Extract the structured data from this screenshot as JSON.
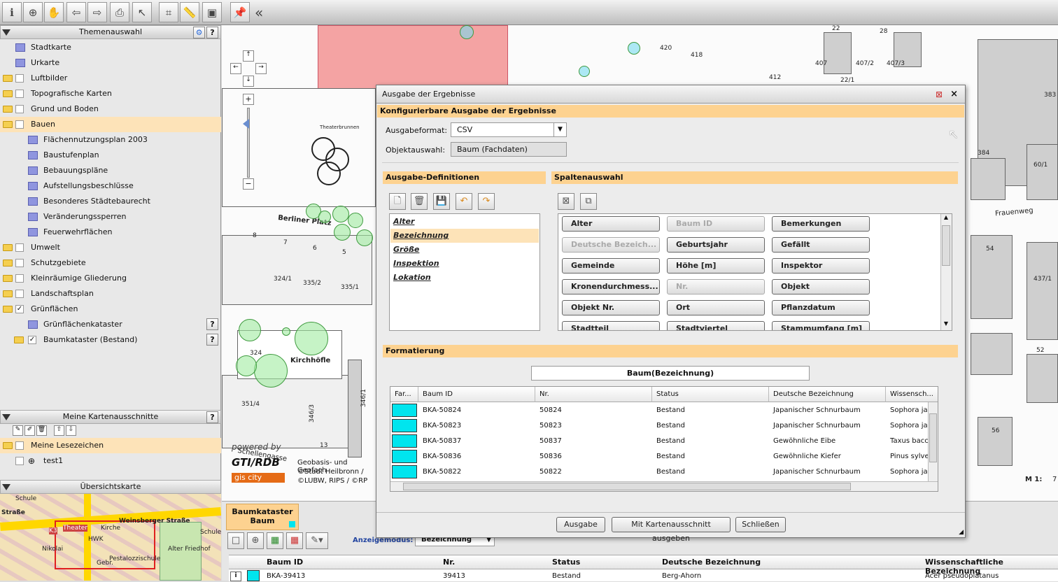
{
  "themen": {
    "header": "Themenauswahl",
    "items": [
      {
        "label": "Stadtkarte"
      },
      {
        "label": "Urkarte"
      },
      {
        "label": "Luftbilder"
      },
      {
        "label": "Topografische Karten"
      },
      {
        "label": "Grund und Boden"
      },
      {
        "label": "Bauen"
      },
      {
        "label": "Flächennutzungsplan 2003"
      },
      {
        "label": "Baustufenplan"
      },
      {
        "label": "Bebauungspläne"
      },
      {
        "label": "Aufstellungsbeschlüsse"
      },
      {
        "label": "Besonderes Städtebaurecht"
      },
      {
        "label": "Veränderungssperren"
      },
      {
        "label": "Feuerwehrflächen"
      },
      {
        "label": "Umwelt"
      },
      {
        "label": "Schutzgebiete"
      },
      {
        "label": "Kleinräumige Gliederung"
      },
      {
        "label": "Landschaftsplan"
      },
      {
        "label": "Grünflächen"
      },
      {
        "label": "Grünflächenkataster"
      },
      {
        "label": "Baumkataster (Bestand)"
      }
    ]
  },
  "kartenausschnitte": {
    "header": "Meine Kartenausschnitte",
    "folder": "Meine Lesezeichen",
    "item": "test1"
  },
  "uebersicht": {
    "header": "Übersichtskarte",
    "labels": [
      "Schule",
      "Straße",
      "Theater",
      "Kirche",
      "Weinsberger Straße",
      "HWK",
      "Pestalozzischule",
      "Alter Friedhof",
      "Gebr.",
      "Nikolai",
      "K3",
      "Schule"
    ]
  },
  "map": {
    "labels": {
      "l1": "Berliner Platz",
      "l2": "Kirchhöfle",
      "l3": "Theaterbrunnen",
      "l4": "Frauenweg",
      "l5": "Schellengasse",
      "m1": "M 1:",
      "m1val": "7"
    },
    "parcels": [
      "22",
      "28",
      "420",
      "418",
      "412",
      "407",
      "407/2",
      "407/3",
      "22/1",
      "383",
      "384",
      "60/1",
      "54",
      "437/1",
      "52",
      "56",
      "8",
      "7",
      "6",
      "5",
      "324/1",
      "335/2",
      "335/1",
      "324",
      "351/4",
      "346/3",
      "346/1",
      "13"
    ],
    "credits": {
      "powered": "powered by",
      "brand": "GTI/RDB",
      "city": "gis city",
      "c1": "Geobasis- und Geofach",
      "c2": "©Stadt Heilbronn /",
      "c3": "©LUBW, RIPS / ©RP"
    }
  },
  "dialog": {
    "title": "Ausgabe der Ergebnisse",
    "subtitle": "Konfigurierbare Ausgabe der Ergebnisse",
    "format_label": "Ausgabeformat:",
    "format_value": "CSV",
    "objekt_label": "Objektauswahl:",
    "objekt_value": "Baum (Fachdaten)",
    "defs_header": "Ausgabe-Definitionen",
    "defs": [
      "Alter",
      "Bezeichnung",
      "Größe",
      "Inspektion",
      "Lokation"
    ],
    "spalten_header": "Spaltenauswahl",
    "spalten": [
      "Alter",
      "Baum ID",
      "Bemerkungen",
      "Deutsche Bezeich...",
      "Geburtsjahr",
      "Gefällt",
      "Gemeinde",
      "Höhe [m]",
      "Inspektor",
      "Kronendurchmess...",
      "Nr.",
      "Objekt",
      "Objekt Nr.",
      "Ort",
      "Pflanzdatum",
      "Stadtteil",
      "Stadtviertel",
      "Stammumfang [m]"
    ],
    "format_header": "Formatierung",
    "format_expr": "Baum(Bezeichnung)",
    "grid": {
      "headers": [
        "Far...",
        "Baum ID",
        "Nr.",
        "Status",
        "Deutsche Bezeichnung",
        "Wissensch..."
      ],
      "rows": [
        [
          "BKA-50824",
          "50824",
          "Bestand",
          "Japanischer Schnurbaum",
          "Sophora jap"
        ],
        [
          "BKA-50823",
          "50823",
          "Bestand",
          "Japanischer Schnurbaum",
          "Sophora jap"
        ],
        [
          "BKA-50837",
          "50837",
          "Bestand",
          "Gewöhnliche Eibe",
          "Taxus bacca"
        ],
        [
          "BKA-50836",
          "50836",
          "Bestand",
          "Gewöhnliche Kiefer",
          "Pinus sylves"
        ],
        [
          "BKA-50822",
          "50822",
          "Bestand",
          "Japanischer Schnurbaum",
          "Sophora jap"
        ]
      ]
    },
    "buttons": {
      "ausgabe": "Ausgabe",
      "karte": "Mit Kartenausschnitt ausgeben",
      "schliessen": "Schließen"
    }
  },
  "bottom": {
    "tab_line1": "Baumkataster",
    "tab_line2": "Baum",
    "mode_label": "Anzeigemodus:",
    "mode_value": "Bezeichnung",
    "headers": [
      "Baum ID",
      "Nr.",
      "Status",
      "Deutsche Bezeichnung",
      "Wissenschaftliche Bezeichnung"
    ],
    "row": [
      "BKA-39413",
      "39413",
      "Bestand",
      "Berg-Ahorn",
      "Acer pseudoplatanus"
    ]
  },
  "colors": {
    "accent": "#fdd290",
    "tree": "#a0eba0",
    "swatch": "#00e5ee",
    "building": "#f4a3a3"
  }
}
